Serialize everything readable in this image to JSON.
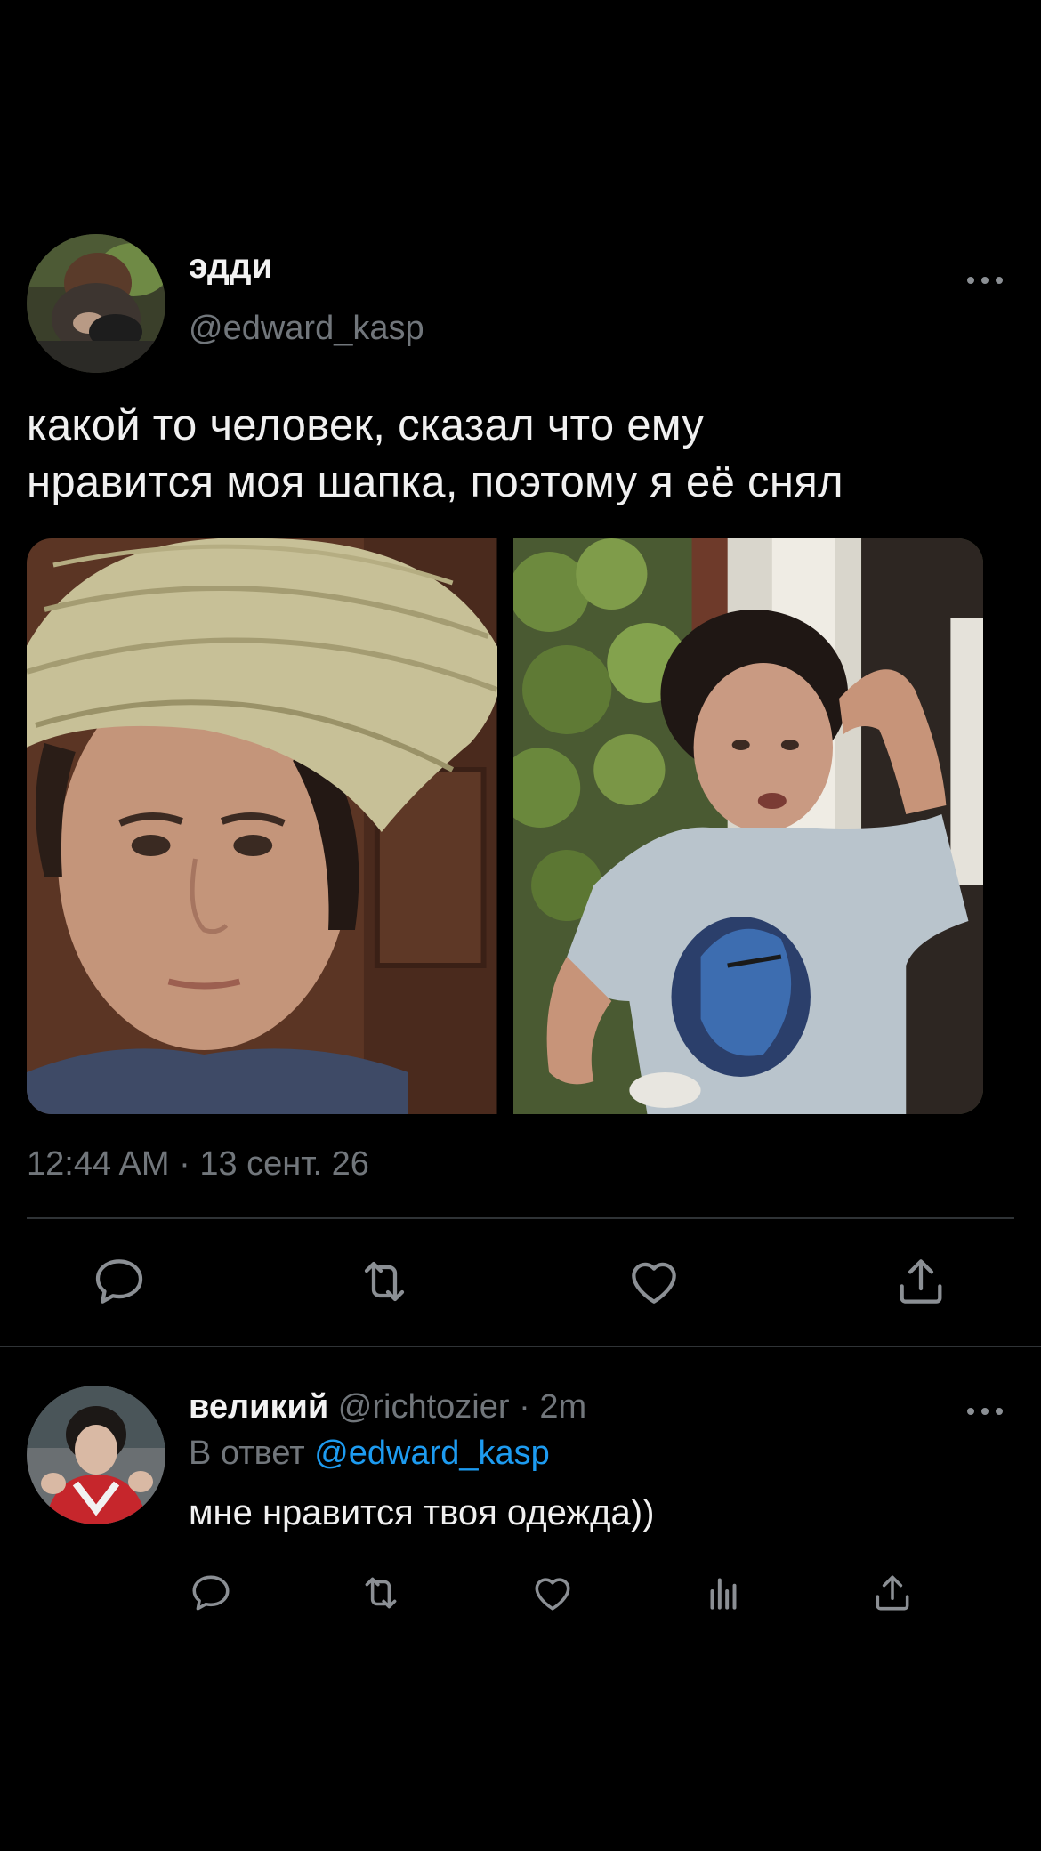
{
  "tweet": {
    "display_name": "эдди",
    "handle": "@edward_kasp",
    "text": "какой то человек, сказал что ему\nнравится моя шапка, поэтому я её снял",
    "timestamp": "12:44 AM · 13 сент. 26",
    "more_label": "•••"
  },
  "reply": {
    "display_name": "великий",
    "handle": "@richtozier",
    "separator": " · ",
    "time": "2m",
    "reply_prefix": "В ответ ",
    "reply_to": "@edward_kasp",
    "text": "мне нравится твоя одежда))",
    "more_label": "•••"
  },
  "icons": {
    "actions": [
      "reply-icon",
      "retweet-icon",
      "like-icon",
      "share-icon"
    ],
    "reply_actions": [
      "reply-icon",
      "retweet-icon",
      "like-icon",
      "analytics-icon",
      "share-icon"
    ]
  },
  "colors": {
    "background": "#000000",
    "text_primary": "#e7e9ea",
    "text_secondary": "#71767b",
    "link": "#1d9bf0",
    "divider": "#2f3336"
  }
}
